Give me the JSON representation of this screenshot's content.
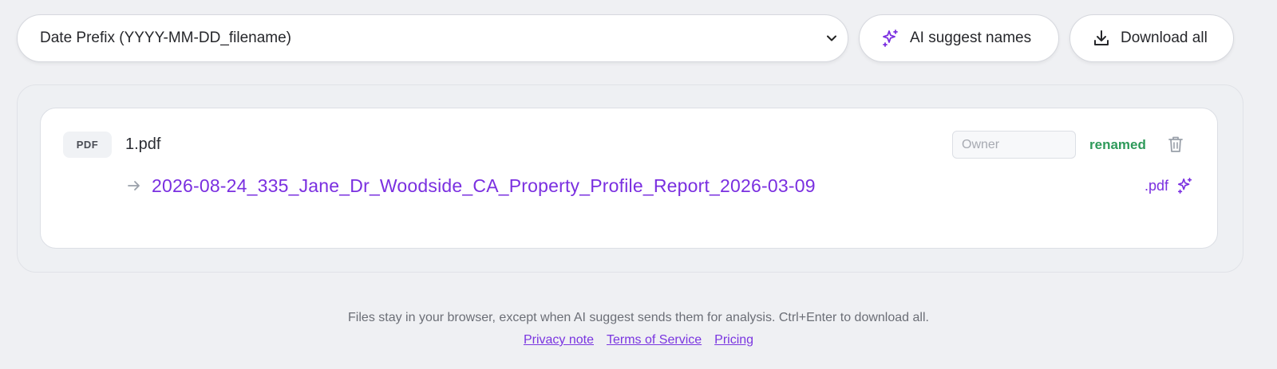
{
  "toolbar": {
    "format_select": {
      "selected": "Date Prefix (YYYY-MM-DD_filename)"
    },
    "ai_button_label": "AI suggest names",
    "download_button_label": "Download all"
  },
  "files": [
    {
      "type_badge": "PDF",
      "original_name": "1.pdf",
      "owner_placeholder": "Owner",
      "owner_value": "",
      "status": "renamed",
      "new_name": "2026-08-24_335_Jane_Dr_Woodside_CA_Property_Profile_Report_2026-03-09",
      "extension": ".pdf"
    }
  ],
  "footer": {
    "note": "Files stay in your browser, except when AI suggest sends them for analysis. Ctrl+Enter to download all.",
    "links": [
      "Privacy note",
      "Terms of Service",
      "Pricing"
    ]
  },
  "colors": {
    "accent": "#7a2fe0",
    "status_ok": "#2e9a5a",
    "background": "#eff0f3"
  },
  "icons": {
    "select_chevron": "chevron-down-icon",
    "ai": "sparkles-icon",
    "download": "download-icon",
    "delete": "trash-icon",
    "rename_arrow": "arrow-right-icon",
    "regenerate": "sparkles-icon"
  }
}
